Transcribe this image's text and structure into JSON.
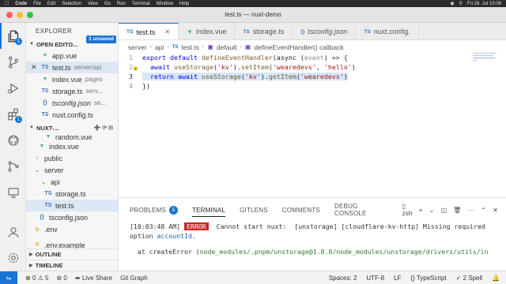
{
  "menubar": {
    "app": "Code",
    "items": [
      "File",
      "Edit",
      "Selection",
      "View",
      "Go",
      "Run",
      "Terminal",
      "Window",
      "Help"
    ],
    "clock": "Fri 28. Jul 10:06"
  },
  "window": {
    "title": "test.ts — nuxt-demo"
  },
  "activity": {
    "explorer_badge": "1",
    "extensions_badge": "1"
  },
  "sidebar": {
    "header": "EXPLORER",
    "open_editors_label": "OPEN EDITO...",
    "unsaved_badge": "1 unsaved",
    "open_editors": [
      {
        "name": "app.vue",
        "desc": ""
      },
      {
        "name": "test.ts",
        "desc": "server/api"
      },
      {
        "name": "index.vue",
        "desc": "pages"
      },
      {
        "name": "storage.ts",
        "desc": "serv..."
      },
      {
        "name": "tsconfig.json",
        "desc": "se..."
      },
      {
        "name": "nuxt.config.ts",
        "desc": ""
      }
    ],
    "project_label": "NUXT-...",
    "tree": [
      {
        "name": "random.vue"
      },
      {
        "name": "index.vue"
      },
      {
        "name": "public"
      },
      {
        "name": "server"
      },
      {
        "name": "api"
      },
      {
        "name": "storage.ts"
      },
      {
        "name": "test.ts"
      },
      {
        "name": "tsconfig.json"
      },
      {
        "name": ".env"
      },
      {
        "name": ".env.example"
      }
    ],
    "outline_label": "OUTLINE",
    "timeline_label": "TIMELINE"
  },
  "tabs": [
    {
      "label": "test.ts",
      "icon": "TS"
    },
    {
      "label": "index.vue",
      "icon": "vue"
    },
    {
      "label": "storage.ts",
      "icon": "TS"
    },
    {
      "label": "tsconfig.json",
      "icon": "{}"
    },
    {
      "label": "nuxt.config.",
      "icon": "TS"
    }
  ],
  "breadcrumb": [
    "server",
    "api",
    "test.ts",
    "default",
    "defineEventHandler() callback"
  ],
  "editor": {
    "line_numbers": [
      "1",
      "2",
      "3",
      "4"
    ],
    "lines": {
      "l1": {
        "kw1": "export default ",
        "fn": "defineEventHandler",
        "rest": "(async (",
        "param": "event",
        "tail": ") => {"
      },
      "l2": {
        "kw": "await ",
        "fn": "useStorage",
        "p1": "(",
        "s1": "'kv'",
        "p2": ").",
        "fn2": "setItem",
        "p3": "(",
        "s2": "'wearedevs'",
        "p4": ", ",
        "s3": "'hello'",
        "p5": ")"
      },
      "l3": {
        "kw": "return ",
        "kw2": "await ",
        "fn": "useStorage",
        "p1": "(",
        "s1": "'kv'",
        "p2": ").",
        "fn2": "getItem",
        "p3": "(",
        "s2": "'wearedevs'",
        "p4": ")"
      },
      "l4": {
        "text": "})"
      }
    }
  },
  "panel": {
    "tabs": [
      "PROBLEMS",
      "TERMINAL",
      "GITLENS",
      "COMMENTS",
      "DEBUG CONSOLE"
    ],
    "problems_count": "5",
    "terminal_shell": "zsh",
    "output": {
      "time": "[10:03:48 AM]",
      "error_badge": "ERROR",
      "msg1": " Cannot start nuxt:  [unstorage] [cloudflare-kv-http] Missing required",
      "msg2a": "option ",
      "msg2b": "accountId",
      "msg2c": ".",
      "msg3a": "  at createError (",
      "msg3b": "node_modules/.pnpm/unstorage@1.8.0/node_modules/unstorage/drivers/utils/in"
    }
  },
  "status": {
    "errors": "0",
    "warnings": "5",
    "ports": "0",
    "live_share": "Live Share",
    "git_graph": "Git Graph",
    "spaces": "Spaces: 2",
    "encoding": "UTF-8",
    "eol": "LF",
    "language": "TypeScript",
    "spell": "2 Spell"
  },
  "colors": {
    "accent": "#1a73d6",
    "error": "#c62828",
    "vue": "#41b883",
    "ts": "#3178c6"
  }
}
